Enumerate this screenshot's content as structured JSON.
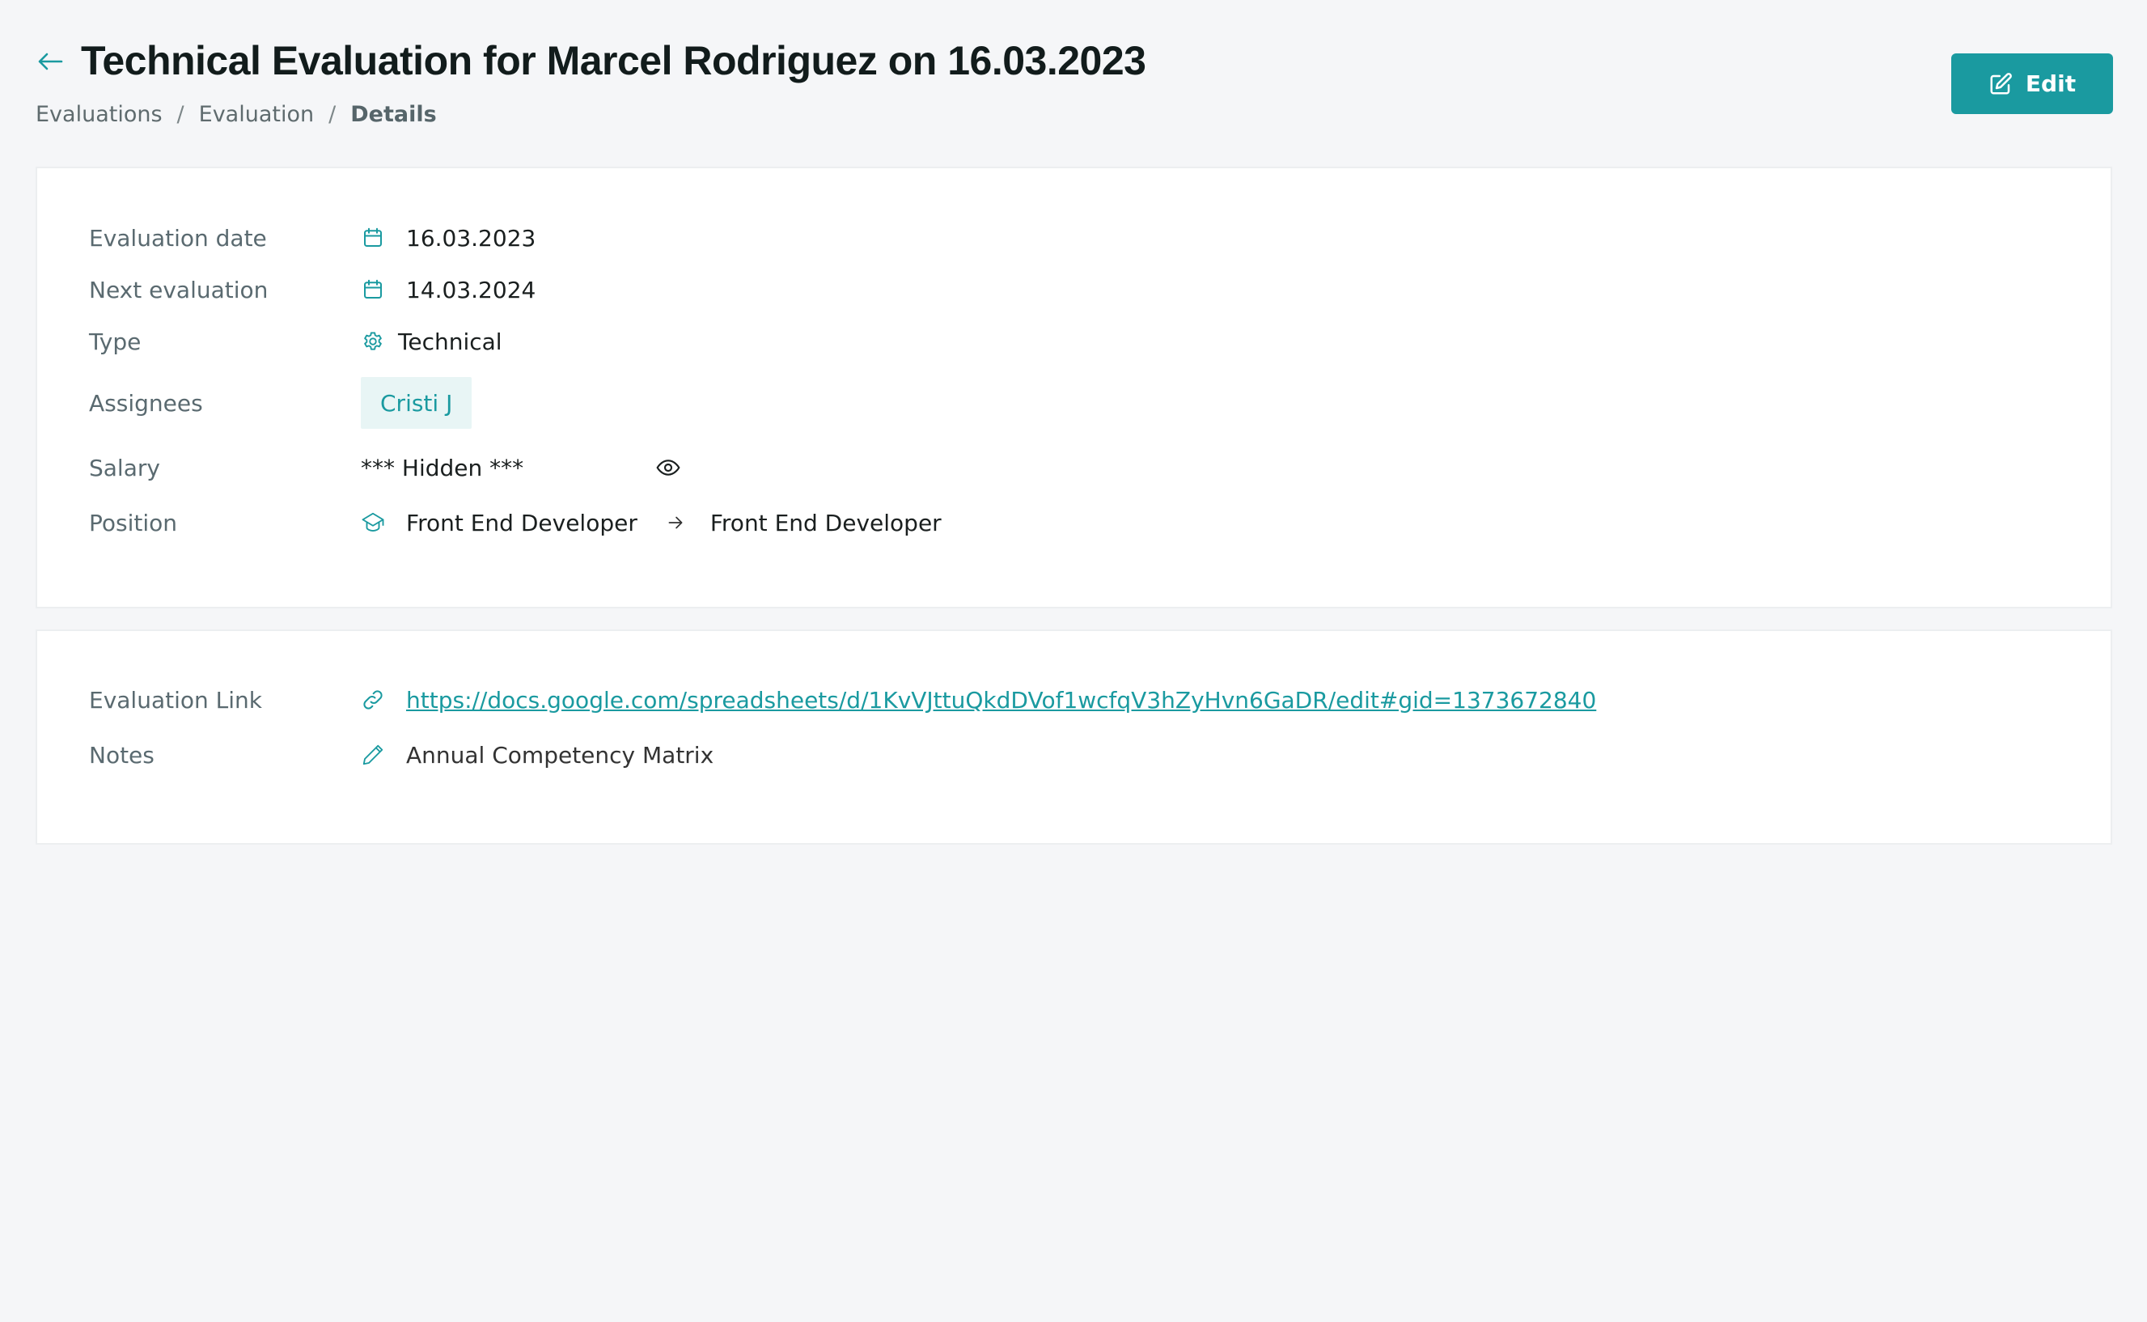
{
  "header": {
    "title": "Technical Evaluation for Marcel Rodriguez on 16.03.2023",
    "back_icon": "arrow-left-icon",
    "breadcrumb": [
      "Evaluations",
      "Evaluation",
      "Details"
    ],
    "breadcrumb_separator": "/",
    "edit_label": "Edit",
    "edit_icon": "edit-square-icon"
  },
  "details": {
    "evaluation_date": {
      "label": "Evaluation date",
      "value": "16.03.2023",
      "icon": "calendar-icon"
    },
    "next_evaluation": {
      "label": "Next evaluation",
      "value": "14.03.2024",
      "icon": "calendar-icon"
    },
    "type": {
      "label": "Type",
      "value": "Technical",
      "icon": "gear-icon"
    },
    "assignees": {
      "label": "Assignees",
      "items": [
        "Cristi J"
      ]
    },
    "salary": {
      "label": "Salary",
      "value": "*** Hidden ***",
      "toggle_icon": "eye-icon"
    },
    "position": {
      "label": "Position",
      "from": "Front End Developer",
      "to": "Front End Developer",
      "icon": "graduation-cap-icon",
      "arrow_icon": "arrow-right-icon"
    }
  },
  "extra": {
    "evaluation_link": {
      "label": "Evaluation Link",
      "value": "https://docs.google.com/spreadsheets/d/1KvVJttuQkdDVof1wcfqV3hZyHvn6GaDR/edit#gid=1373672840",
      "icon": "link-icon"
    },
    "notes": {
      "label": "Notes",
      "value": "Annual Competency Matrix",
      "icon": "pencil-icon"
    }
  },
  "colors": {
    "accent": "#1a9aa0",
    "background": "#f5f6f8",
    "chip_background": "#e8f5f5",
    "label_text": "#5a6a70"
  }
}
